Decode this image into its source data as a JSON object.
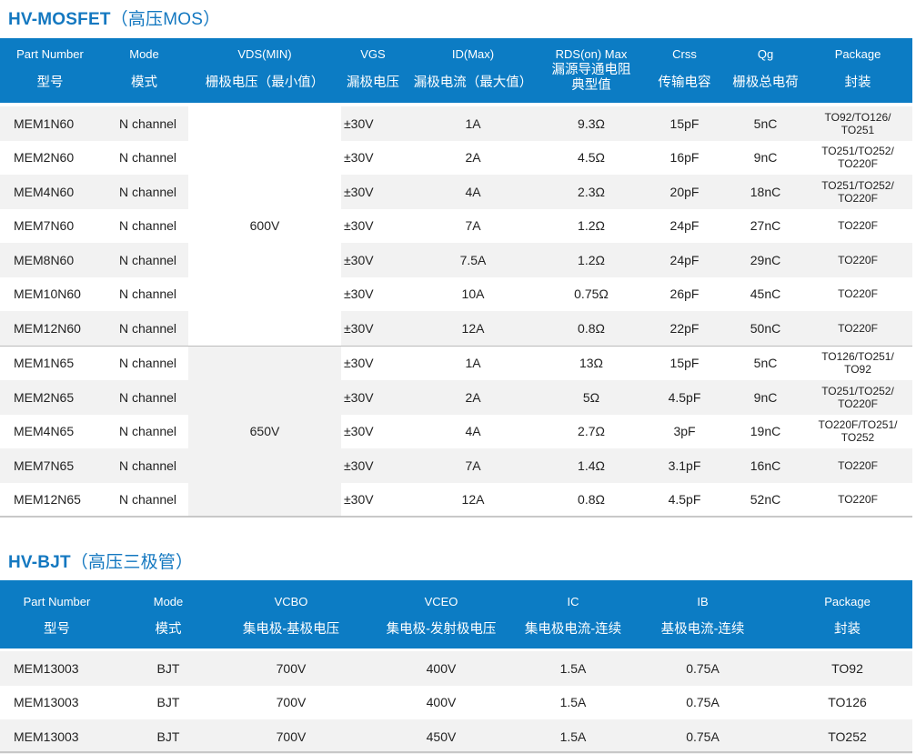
{
  "mosfet": {
    "title": "HV-MOSFET",
    "title_sub": "（高压MOS）",
    "headers": [
      {
        "en": "Part Number",
        "cn": "型号"
      },
      {
        "en": "Mode",
        "cn": "模式"
      },
      {
        "en": "VDS(MIN)",
        "cn": "栅极电压（最小值）"
      },
      {
        "en": "VGS",
        "cn": "漏极电压"
      },
      {
        "en": "ID(Max)",
        "cn": "漏极电流（最大值）"
      },
      {
        "en": "RDS(on) Max",
        "cn": "漏源导通电阻\n典型值"
      },
      {
        "en": "Crss",
        "cn": "传输电容"
      },
      {
        "en": "Qg",
        "cn": "栅极总电荷"
      },
      {
        "en": "Package",
        "cn": "封装"
      }
    ],
    "groups": [
      {
        "vds": "600V",
        "rows": [
          [
            "MEM1N60",
            "N channel",
            "±30V",
            "1A",
            "9.3Ω",
            "15pF",
            "5nC",
            "TO92/TO126/\nTO251"
          ],
          [
            "MEM2N60",
            "N channel",
            "±30V",
            "2A",
            "4.5Ω",
            "16pF",
            "9nC",
            "TO251/TO252/\nTO220F"
          ],
          [
            "MEM4N60",
            "N channel",
            "±30V",
            "4A",
            "2.3Ω",
            "20pF",
            "18nC",
            "TO251/TO252/\nTO220F"
          ],
          [
            "MEM7N60",
            "N channel",
            "±30V",
            "7A",
            "1.2Ω",
            "24pF",
            "27nC",
            "TO220F"
          ],
          [
            "MEM8N60",
            "N channel",
            "±30V",
            "7.5A",
            "1.2Ω",
            "24pF",
            "29nC",
            "TO220F"
          ],
          [
            "MEM10N60",
            "N channel",
            "±30V",
            "10A",
            "0.75Ω",
            "26pF",
            "45nC",
            "TO220F"
          ],
          [
            "MEM12N60",
            "N channel",
            "±30V",
            "12A",
            "0.8Ω",
            "22pF",
            "50nC",
            "TO220F"
          ]
        ]
      },
      {
        "vds": "650V",
        "rows": [
          [
            "MEM1N65",
            "N channel",
            "±30V",
            "1A",
            "13Ω",
            "15pF",
            "5nC",
            "TO126/TO251/\nTO92"
          ],
          [
            "MEM2N65",
            "N channel",
            "±30V",
            "2A",
            "5Ω",
            "4.5pF",
            "9nC",
            "TO251/TO252/\nTO220F"
          ],
          [
            "MEM4N65",
            "N channel",
            "±30V",
            "4A",
            "2.7Ω",
            "3pF",
            "19nC",
            "TO220F/TO251/\nTO252"
          ],
          [
            "MEM7N65",
            "N channel",
            "±30V",
            "7A",
            "1.4Ω",
            "3.1pF",
            "16nC",
            "TO220F"
          ],
          [
            "MEM12N65",
            "N channel",
            "±30V",
            "12A",
            "0.8Ω",
            "4.5pF",
            "52nC",
            "TO220F"
          ]
        ]
      }
    ]
  },
  "bjt": {
    "title": "HV-BJT",
    "title_sub": "（高压三极管）",
    "headers": [
      {
        "en": "Part Number",
        "cn": "型号"
      },
      {
        "en": "Mode",
        "cn": "模式"
      },
      {
        "en": "VCBO",
        "cn": "集电极-基极电压"
      },
      {
        "en": "VCEO",
        "cn": "集电极-发射极电压"
      },
      {
        "en": "IC",
        "cn": "集电极电流-连续"
      },
      {
        "en": "IB",
        "cn": "基极电流-连续"
      },
      {
        "en": "Package",
        "cn": "封装"
      }
    ],
    "rows": [
      [
        "MEM13003",
        "BJT",
        "700V",
        "400V",
        "1.5A",
        "0.75A",
        "TO92"
      ],
      [
        "MEM13003",
        "BJT",
        "700V",
        "400V",
        "1.5A",
        "0.75A",
        "TO126"
      ],
      [
        "MEM13003",
        "BJT",
        "700V",
        "450V",
        "1.5A",
        "0.75A",
        "TO252"
      ]
    ]
  }
}
